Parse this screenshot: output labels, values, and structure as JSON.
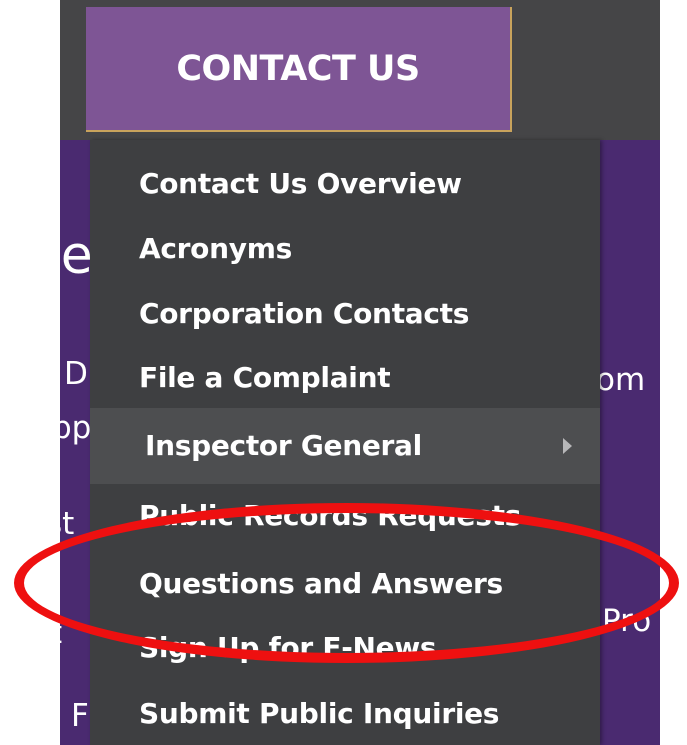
{
  "nav": {
    "active_tab": "CONTACT US"
  },
  "background_fragments": {
    "heading": "ve",
    "line_1": "D",
    "line_2": "pp",
    "line_3": "st",
    "line_4": "t",
    "line_5": "I F",
    "right_1": "om",
    "right_2": "Pro"
  },
  "dropdown": {
    "items": [
      {
        "label": "Contact Us Overview"
      },
      {
        "label": "Acronyms"
      },
      {
        "label": "Corporation Contacts"
      },
      {
        "label": "File a Complaint"
      },
      {
        "label": "Inspector General",
        "has_submenu": true,
        "highlighted": true
      },
      {
        "label": "Public Records Requests"
      },
      {
        "label": "Questions and Answers",
        "annotated": true
      },
      {
        "label": "Sign Up for E-News"
      },
      {
        "label": "Submit Public Inquiries"
      }
    ]
  },
  "annotation": {
    "shape": "ellipse",
    "color": "#ee1010"
  },
  "colors": {
    "active_tab": "#7e5595",
    "dropdown_bg": "#3e3f41",
    "page_bg": "#4a2a70",
    "topbar": "#454547"
  }
}
